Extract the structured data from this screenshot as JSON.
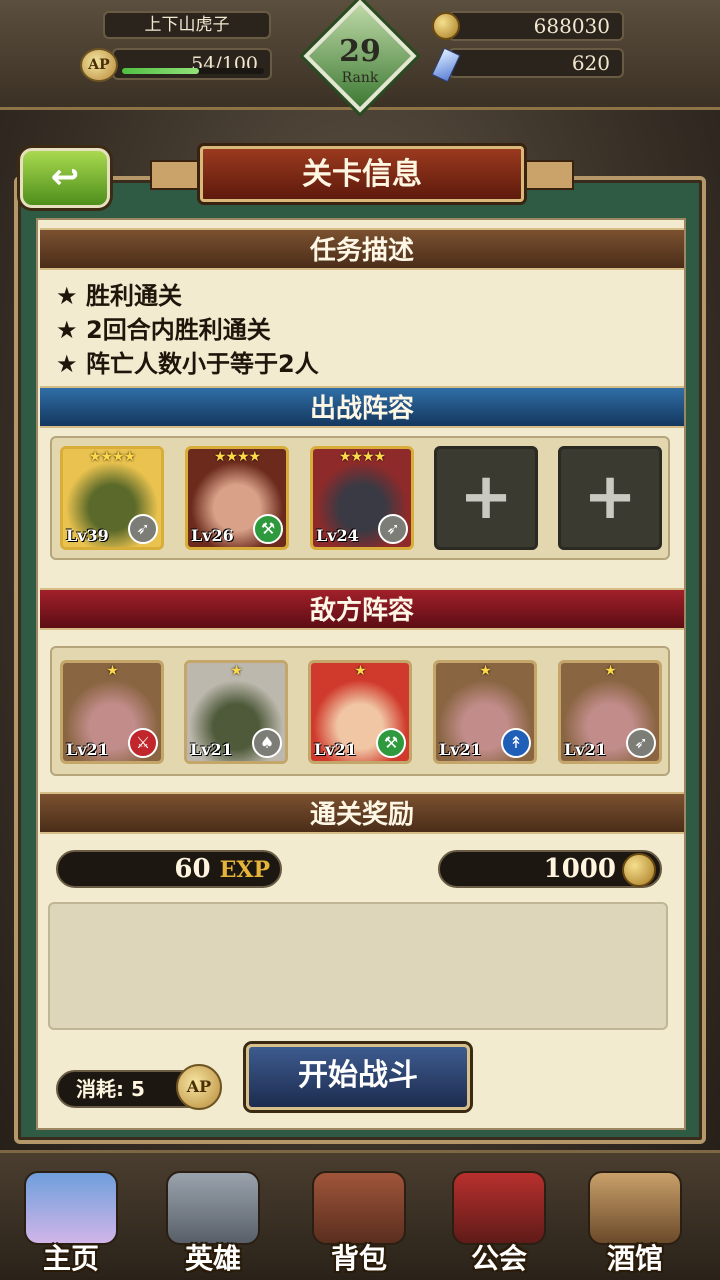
{
  "top_bar": {
    "player_name": "上下山虎子",
    "ap_icon_label": "AP",
    "ap_text": "54/100",
    "ap_fraction": 0.54,
    "rank_number": "29",
    "rank_label": "Rank",
    "gold": "688030",
    "gems": "620"
  },
  "header": {
    "back_icon": "↩",
    "title": "关卡信息"
  },
  "mission": {
    "heading": "任务描述",
    "star_glyph": "★",
    "items": [
      "胜利通关",
      "2回合内胜利通关",
      "阵亡人数小于等于2人"
    ]
  },
  "team": {
    "heading": "出战阵容",
    "heroes": [
      {
        "level": "Lv39",
        "stars": "★★★★",
        "class_icon": "bow-icon",
        "class_glyph": "➶",
        "class_color": "#7d7d78",
        "face_a": "#e9c24f",
        "face_b": "#5b6a2a"
      },
      {
        "level": "Lv26",
        "stars": "★★★★",
        "class_icon": "axe-icon",
        "class_glyph": "⚒",
        "class_color": "#2f9a3d",
        "face_a": "#6b2a1c",
        "face_b": "#d9a188"
      },
      {
        "level": "Lv24",
        "stars": "★★★★",
        "class_icon": "bow-icon",
        "class_glyph": "➶",
        "class_color": "#7d7d78",
        "face_a": "#8f2a2a",
        "face_b": "#3a3a44"
      }
    ],
    "empty_slot_glyph": "+"
  },
  "enemy": {
    "heading": "敌方阵容",
    "units": [
      {
        "level": "Lv21",
        "stars": "★",
        "class_icon": "sword-icon",
        "class_glyph": "⚔",
        "class_color": "#c0262b",
        "face_a": "#8a6542",
        "face_b": "#c18c8a"
      },
      {
        "level": "Lv21",
        "stars": "★",
        "class_icon": "mace-icon",
        "class_glyph": "♠",
        "class_color": "#7d7d78",
        "face_a": "#bdb8ad",
        "face_b": "#4e5a3a"
      },
      {
        "level": "Lv21",
        "stars": "★",
        "class_icon": "axe-icon",
        "class_glyph": "⚒",
        "class_color": "#2f9a3d",
        "face_a": "#d03a2c",
        "face_b": "#f0c6a4"
      },
      {
        "level": "Lv21",
        "stars": "★",
        "class_icon": "spear-icon",
        "class_glyph": "↟",
        "class_color": "#1f5fb8",
        "face_a": "#8a6542",
        "face_b": "#c18c8a"
      },
      {
        "level": "Lv21",
        "stars": "★",
        "class_icon": "bow-icon",
        "class_glyph": "➶",
        "class_color": "#7d7d78",
        "face_a": "#8a6542",
        "face_b": "#c18c8a"
      }
    ]
  },
  "rewards": {
    "heading": "通关奖励",
    "exp_value": "60",
    "exp_label": "EXP",
    "gold_value": "1000"
  },
  "footer": {
    "cost_label": "消耗:",
    "cost_value": "5",
    "cost_icon_label": "AP",
    "start_button": "开始战斗"
  },
  "bottom_nav": [
    {
      "label": "主页",
      "icon": "castle-icon",
      "color_a": "#6f9fdc",
      "color_b": "#d1b5e8"
    },
    {
      "label": "英雄",
      "icon": "helmet-icon",
      "color_a": "#9aa3ad",
      "color_b": "#585f68"
    },
    {
      "label": "背包",
      "icon": "backpack-icon",
      "color_a": "#a0553a",
      "color_b": "#5a2e1e"
    },
    {
      "label": "公会",
      "icon": "guild-crest-icon",
      "color_a": "#b8302e",
      "color_b": "#5f1b18"
    },
    {
      "label": "酒馆",
      "icon": "tavern-mug-icon",
      "color_a": "#c9a06a",
      "color_b": "#6b4a2a"
    }
  ]
}
